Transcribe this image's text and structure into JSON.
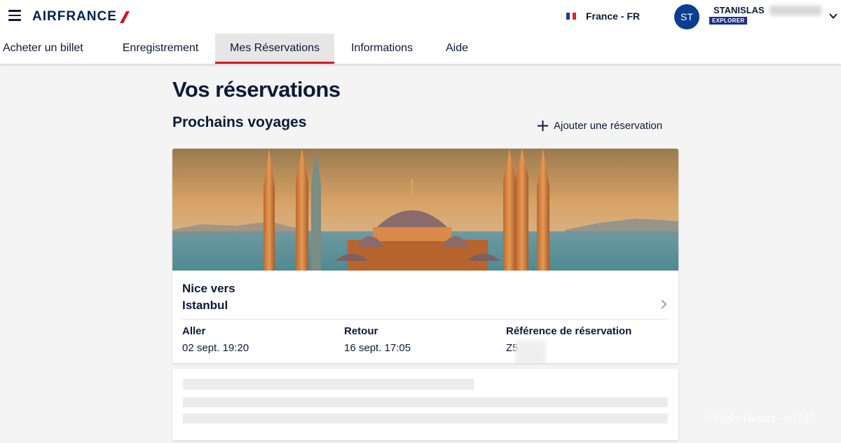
{
  "header": {
    "brand": "AIRFRANCE",
    "language": "France - FR",
    "avatar_initials": "ST",
    "user_first_name": "STANISLAS",
    "tier": "EXPLORER"
  },
  "nav": {
    "items": [
      {
        "label": "Acheter un billet",
        "active": false
      },
      {
        "label": "Enregistrement",
        "active": false
      },
      {
        "label": "Mes Réservations",
        "active": true
      },
      {
        "label": "Informations",
        "active": false
      },
      {
        "label": "Aide",
        "active": false
      }
    ]
  },
  "main": {
    "title": "Vos réservations",
    "section_title": "Prochains voyages",
    "add_link": "Ajouter une réservation"
  },
  "trip": {
    "from_line": "Nice vers",
    "to_line": "Istanbul",
    "outbound_label": "Aller",
    "outbound_value": "02 sept. 19:20",
    "return_label": "Retour",
    "return_value": "16 sept. 17:05",
    "reference_label": "Référence de réservation",
    "reference_value": "Z5"
  },
  "watermark": "© Flight-Report - st7515",
  "colors": {
    "brand_navy": "#002157",
    "active_tab_underline": "#d3181e",
    "avatar_bg": "#0b3d91",
    "tier_badge_bg": "#1c2c8c",
    "page_bg": "#f4f4f4"
  },
  "icons": {
    "menu": "hamburger-icon",
    "flag": "france-flag-icon",
    "dropdown": "chevron-down-icon",
    "add": "plus-icon",
    "open_trip": "chevron-right-icon"
  }
}
